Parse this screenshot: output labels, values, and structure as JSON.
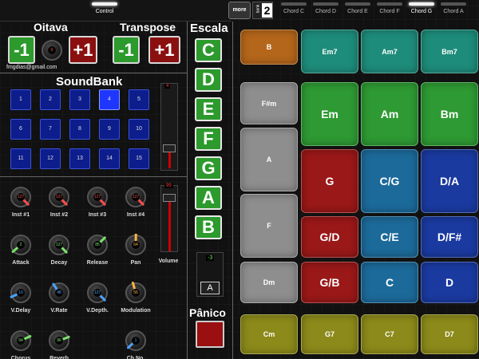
{
  "topbar": {
    "control_label": "Control",
    "more_label": "more",
    "bank_label": "bank",
    "bank_number": "2",
    "chord_tabs": [
      "Chord C",
      "Chord D",
      "Chord E",
      "Chord F",
      "Chord G",
      "Chord A"
    ],
    "active_chord_tab": "Chord G"
  },
  "oitava": {
    "title": "Oitava",
    "minus": "-1",
    "plus": "+1",
    "value": "0",
    "email": "fmgdias@gmail.com"
  },
  "transpose": {
    "title": "Transpose",
    "minus": "-1",
    "plus": "+1"
  },
  "soundbank": {
    "title": "SoundBank",
    "buttons": [
      "1",
      "2",
      "3",
      "4",
      "5",
      "6",
      "7",
      "8",
      "9",
      "10",
      "11",
      "12",
      "13",
      "14",
      "15"
    ],
    "selected": "4",
    "slider_value": "4"
  },
  "knobs": [
    {
      "label": "Inst #1",
      "value": "127",
      "color": "#ff4d4d"
    },
    {
      "label": "Inst #2",
      "value": "127",
      "color": "#ff4d4d"
    },
    {
      "label": "Inst #3",
      "value": "127",
      "color": "#ff4d4d"
    },
    {
      "label": "Inst #4",
      "value": "127",
      "color": "#ff4d4d"
    },
    {
      "label": "Attack",
      "value": "2",
      "color": "#7be36b"
    },
    {
      "label": "Decay",
      "value": "127",
      "color": "#7be36b"
    },
    {
      "label": "Release",
      "value": "85",
      "color": "#7be36b"
    },
    {
      "label": "Pan",
      "value": "64",
      "color": "#ffb347"
    },
    {
      "label": "V.Delay",
      "value": "10",
      "color": "#4aa3ff"
    },
    {
      "label": "V.Rate",
      "value": "48",
      "color": "#4aa3ff"
    },
    {
      "label": "V.Depth.",
      "value": "127",
      "color": "#4aa3ff"
    },
    {
      "label": "Modulation",
      "value": "56",
      "color": "#ffb347"
    },
    {
      "label": "Chorus",
      "value": "94",
      "color": "#7be36b"
    },
    {
      "label": "Reverb",
      "value": "96",
      "color": "#7be36b"
    },
    {
      "label": "Ch.No.",
      "value": "1",
      "color": "#4aa3ff"
    }
  ],
  "volume": {
    "label": "Volume",
    "value": "99"
  },
  "escala": {
    "title": "Escala",
    "notes": [
      "C",
      "D",
      "E",
      "F",
      "G",
      "A",
      "B"
    ],
    "transpose_value": "-3",
    "key": "A"
  },
  "panico": {
    "title": "Pânico"
  },
  "pads": {
    "col0": [
      "B",
      "F#m",
      "A",
      "F",
      "Dm",
      "Cm"
    ],
    "grid": [
      [
        "Em7",
        "Am7",
        "Bm7"
      ],
      [
        "Em",
        "Am",
        "Bm"
      ],
      [
        "G",
        "C/G",
        "D/A"
      ],
      [
        "G/D",
        "C/E",
        "D/F#"
      ],
      [
        "G/B",
        "C",
        "D"
      ],
      [
        "G7",
        "C7",
        "D7"
      ]
    ]
  },
  "colors": {
    "green": "#2c9a2c",
    "red": "#8a1010",
    "orange": "#b4661a",
    "teal": "#1e8c7a",
    "gray": "#8e8e8e",
    "pad_green": "#2e9a33",
    "pad_red": "#9a1818",
    "pad_blue1": "#1c6a9a",
    "pad_blue2": "#1a3aa0",
    "olive": "#8c8a1a"
  }
}
